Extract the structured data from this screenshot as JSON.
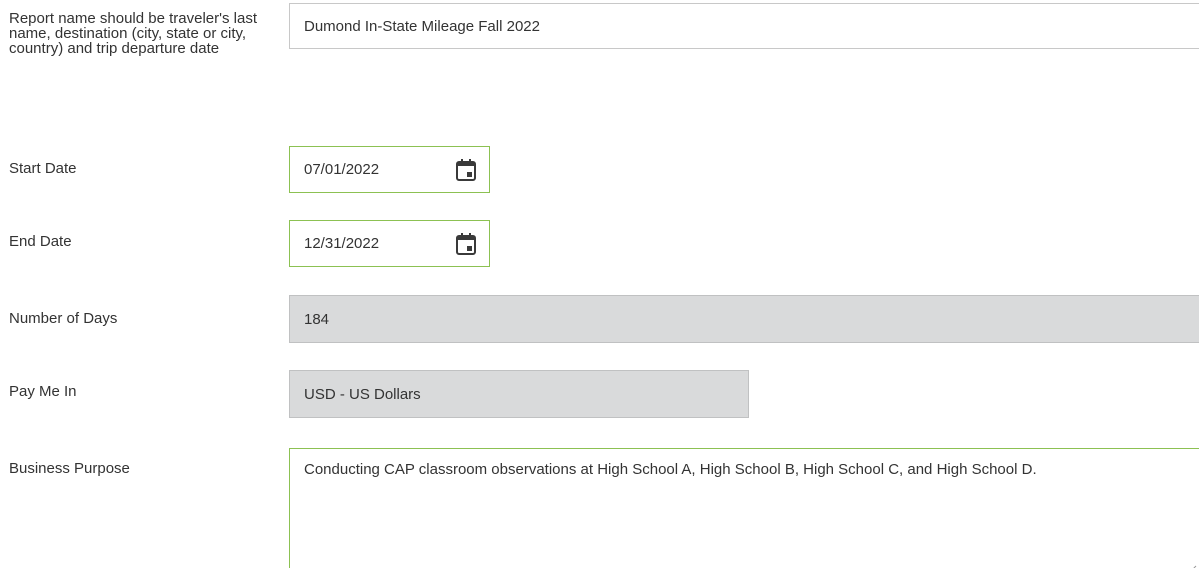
{
  "report_name": {
    "label": "Report name should be traveler's last name, destination (city, state or city, country) and trip departure date",
    "value": "Dumond In-State Mileage Fall 2022"
  },
  "start_date": {
    "label": "Start Date",
    "value": "07/01/2022",
    "icon": "calendar-icon"
  },
  "end_date": {
    "label": "End Date",
    "value": "12/31/2022",
    "icon": "calendar-icon"
  },
  "number_of_days": {
    "label": "Number of Days",
    "value": "184"
  },
  "pay_me_in": {
    "label": "Pay Me In",
    "value": "USD - US Dollars"
  },
  "business_purpose": {
    "label": "Business Purpose",
    "value": "Conducting CAP classroom observations at High School A, High School B, High School C, and High School D."
  },
  "colors": {
    "focus_border": "#8cc152",
    "readonly_bg": "#d9dadb",
    "text": "#333333"
  }
}
